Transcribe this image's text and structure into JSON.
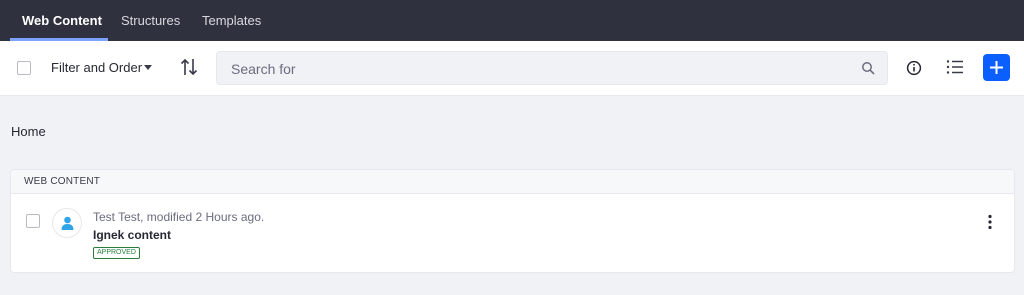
{
  "nav": {
    "tabs": [
      {
        "label": "Web Content",
        "active": true
      },
      {
        "label": "Structures",
        "active": false
      },
      {
        "label": "Templates",
        "active": false
      }
    ]
  },
  "toolbar": {
    "filter_label": "Filter and Order",
    "search_placeholder": "Search for",
    "icons": [
      "caret-down-icon",
      "sort-icon",
      "search-icon",
      "info-icon",
      "list-view-icon",
      "plus-icon"
    ]
  },
  "breadcrumb": "Home",
  "section": {
    "header": "WEB CONTENT",
    "items": [
      {
        "meta": "Test Test, modified 2 Hours ago.",
        "title": "Ignek content",
        "status": "APPROVED"
      }
    ]
  },
  "colors": {
    "nav_bg": "#30313f",
    "primary": "#0b5fff",
    "approved": "#287d3c",
    "avatar": "#2fa4e7"
  }
}
